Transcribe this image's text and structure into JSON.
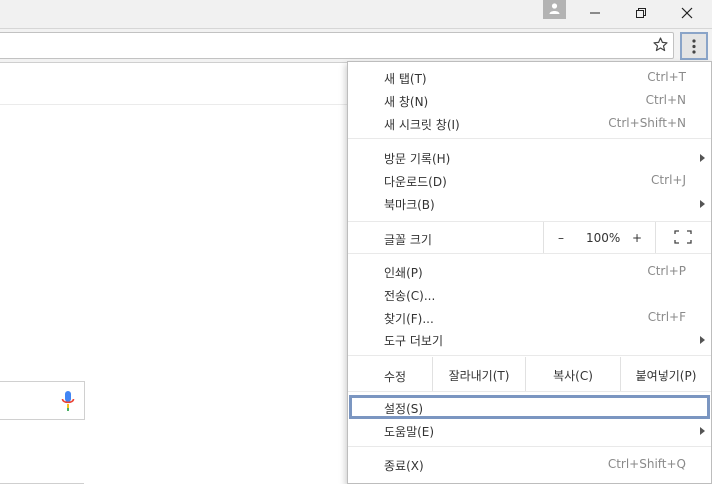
{
  "menu": {
    "new_tab": {
      "label": "새 탭(T)",
      "shortcut": "Ctrl+T"
    },
    "new_window": {
      "label": "새 창(N)",
      "shortcut": "Ctrl+N"
    },
    "new_incognito": {
      "label": "새 시크릿 창(I)",
      "shortcut": "Ctrl+Shift+N"
    },
    "history": {
      "label": "방문 기록(H)"
    },
    "downloads": {
      "label": "다운로드(D)",
      "shortcut": "Ctrl+J"
    },
    "bookmarks": {
      "label": "북마크(B)"
    },
    "zoom": {
      "label": "글꼴 크기",
      "minus": "–",
      "value": "100%",
      "plus": "+"
    },
    "print": {
      "label": "인쇄(P)",
      "shortcut": "Ctrl+P"
    },
    "cast": {
      "label": "전송(C)..."
    },
    "find": {
      "label": "찾기(F)...",
      "shortcut": "Ctrl+F"
    },
    "more_tools": {
      "label": "도구 더보기"
    },
    "edit": {
      "label": "수정",
      "cut": "잘라내기(T)",
      "copy": "복사(C)",
      "paste": "붙여넣기(P)"
    },
    "settings": {
      "label": "설정(S)"
    },
    "help": {
      "label": "도움말(E)"
    },
    "exit": {
      "label": "종료(X)",
      "shortcut": "Ctrl+Shift+Q"
    }
  },
  "colors": {
    "highlight_border": "#7b96c1",
    "shortcut_text": "#8a8a8a"
  }
}
